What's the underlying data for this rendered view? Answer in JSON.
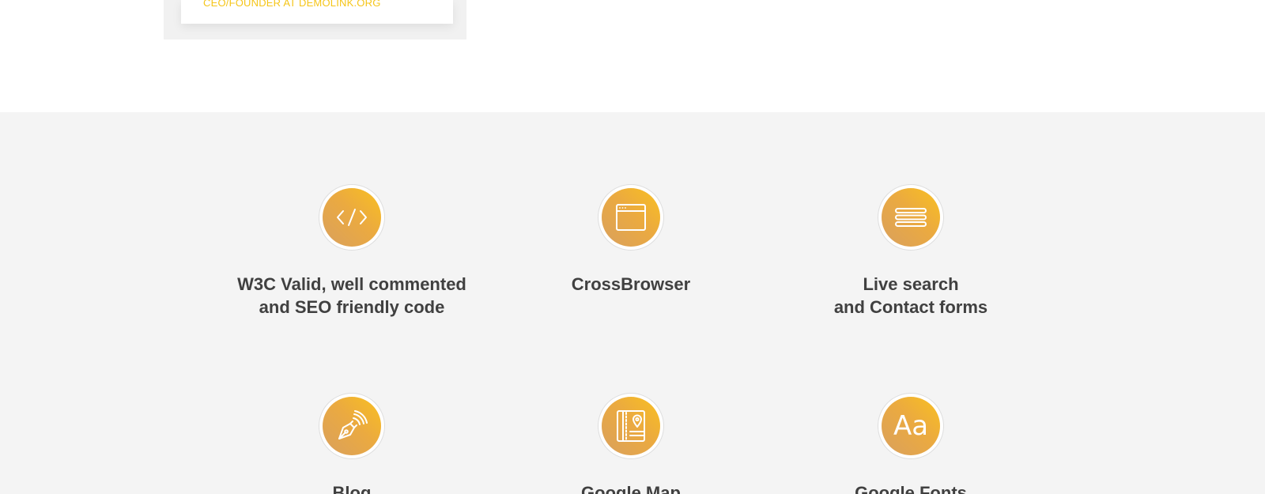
{
  "testimonial": {
    "author_role": "CEO/FOUNDER AT DEMOLINK.ORG"
  },
  "features": [
    {
      "icon": "code-icon",
      "title_line1": "W3C Valid, well commented",
      "title_line2": "and SEO friendly code"
    },
    {
      "icon": "browser-window-icon",
      "title_line1": "CrossBrowser",
      "title_line2": ""
    },
    {
      "icon": "menu-lines-icon",
      "title_line1": "Live search",
      "title_line2": "and Contact forms"
    },
    {
      "icon": "pen-nib-icon",
      "title_line1": "Blog",
      "title_line2": ""
    },
    {
      "icon": "map-book-icon",
      "title_line1": "Google Map",
      "title_line2": ""
    },
    {
      "icon": "font-icon",
      "title_line1": "Google Fonts",
      "title_line2": "",
      "icon_text": "Aa"
    }
  ],
  "colors": {
    "accent": "#f5c518",
    "icon_gradient_start": "#f9c020",
    "icon_gradient_end": "#d9a05e",
    "heading": "#404040",
    "section_bg": "#f4f4f4"
  }
}
